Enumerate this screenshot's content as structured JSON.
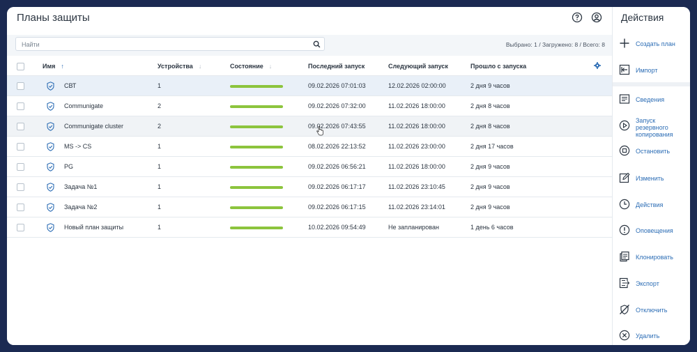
{
  "page": {
    "title": "Планы защиты"
  },
  "search": {
    "placeholder": "Найти"
  },
  "counts": {
    "text": "Выбрано: 1 / Загружено: 8 / Всего: 8"
  },
  "table": {
    "columns": [
      "Имя",
      "Устройства",
      "Состояние",
      "Последний запуск",
      "Следующий запуск",
      "Прошло с запуска"
    ],
    "rows": [
      {
        "name": "СВТ",
        "devices": "1",
        "last": "09.02.2026 07:01:03",
        "next": "12.02.2026 02:00:00",
        "since": "2 дня 9 часов"
      },
      {
        "name": "Communigate",
        "devices": "2",
        "last": "09.02.2026 07:32:00",
        "next": "11.02.2026 18:00:00",
        "since": "2 дня 8 часов"
      },
      {
        "name": "Communigate cluster",
        "devices": "2",
        "last": "09.02.2026 07:43:55",
        "next": "11.02.2026 18:00:00",
        "since": "2 дня 8 часов"
      },
      {
        "name": "MS -> CS",
        "devices": "1",
        "last": "08.02.2026 22:13:52",
        "next": "11.02.2026 23:00:00",
        "since": "2 дня 17 часов"
      },
      {
        "name": "PG",
        "devices": "1",
        "last": "09.02.2026 06:56:21",
        "next": "11.02.2026 18:00:00",
        "since": "2 дня 9 часов"
      },
      {
        "name": "Задача №1",
        "devices": "1",
        "last": "09.02.2026 06:17:17",
        "next": "11.02.2026 23:10:45",
        "since": "2 дня 9 часов"
      },
      {
        "name": "Задача №2",
        "devices": "1",
        "last": "09.02.2026 06:17:15",
        "next": "11.02.2026 23:14:01",
        "since": "2 дня 9 часов"
      },
      {
        "name": "Новый план защиты",
        "devices": "1",
        "last": "10.02.2026 09:54:49",
        "next": "Не запланирован",
        "since": "1 день 6 часов"
      }
    ]
  },
  "sidebar": {
    "title": "Действия",
    "actions": [
      {
        "label": "Создать план",
        "icon": "plus-icon"
      },
      {
        "label": "Импорт",
        "icon": "import-icon"
      },
      {
        "label": "Сведения",
        "icon": "details-icon"
      },
      {
        "label": "Запуск резервного копирования",
        "icon": "play-icon"
      },
      {
        "label": "Остановить",
        "icon": "stop-icon"
      },
      {
        "label": "Изменить",
        "icon": "edit-icon"
      },
      {
        "label": "Действия",
        "icon": "clock-icon"
      },
      {
        "label": "Оповещения",
        "icon": "alert-icon"
      },
      {
        "label": "Клонировать",
        "icon": "clone-icon"
      },
      {
        "label": "Экспорт",
        "icon": "export-icon"
      },
      {
        "label": "Отключить",
        "icon": "disable-icon"
      },
      {
        "label": "Удалить",
        "icon": "delete-icon"
      }
    ]
  },
  "colors": {
    "accent": "#2c6db5",
    "status_ok": "#8cc43d",
    "selected_row": "#e9f0f8",
    "background": "#1b2a52"
  }
}
